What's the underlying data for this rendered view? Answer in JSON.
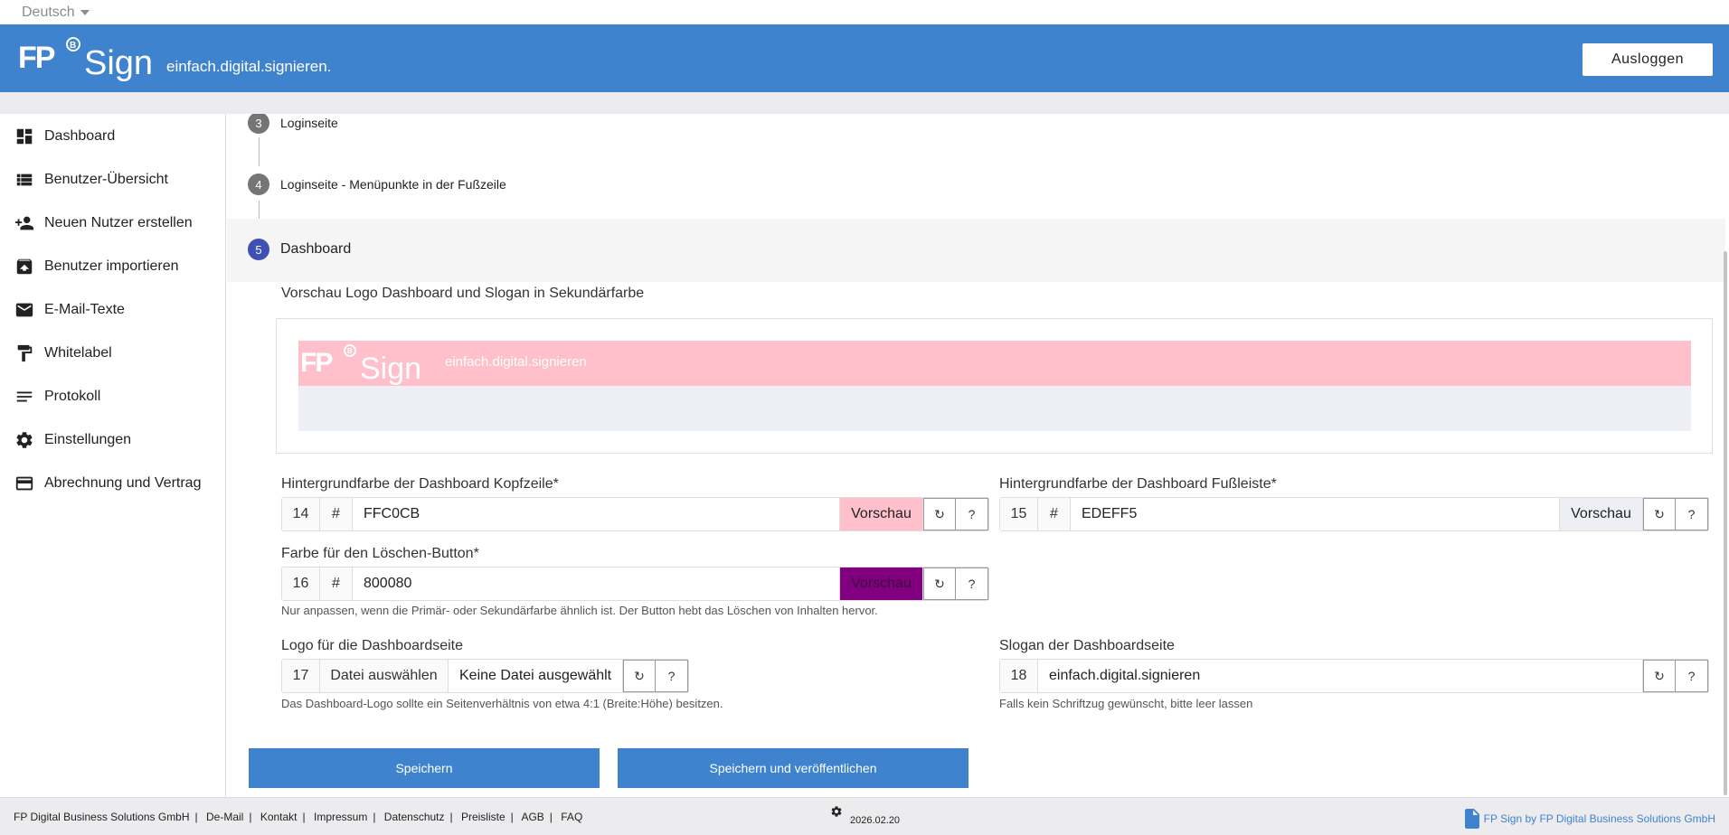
{
  "language": {
    "selected": "Deutsch"
  },
  "header": {
    "logo_text": "FP Sign",
    "slogan": "einfach.digital.signieren.",
    "logout_label": "Ausloggen",
    "color": "#3f83cf"
  },
  "sidebar": {
    "items": [
      {
        "label": "Dashboard",
        "icon": "dashboard-icon"
      },
      {
        "label": "Benutzer-Übersicht",
        "icon": "list-icon"
      },
      {
        "label": "Neuen Nutzer erstellen",
        "icon": "person-add-icon"
      },
      {
        "label": "Benutzer importieren",
        "icon": "archive-icon"
      },
      {
        "label": "E-Mail-Texte",
        "icon": "mail-icon"
      },
      {
        "label": "Whitelabel",
        "icon": "paint-roller-icon"
      },
      {
        "label": "Protokoll",
        "icon": "notes-icon"
      },
      {
        "label": "Einstellungen",
        "icon": "gear-icon"
      },
      {
        "label": "Abrechnung und Vertrag",
        "icon": "credit-card-icon"
      }
    ]
  },
  "steps": [
    {
      "num": "3",
      "label": "Loginseite"
    },
    {
      "num": "4",
      "label": "Loginseite - Menüpunkte in der Fußzeile"
    },
    {
      "num": "5",
      "label": "Dashboard"
    }
  ],
  "preview": {
    "title": "Vorschau Logo Dashboard und Slogan in Sekundärfarbe",
    "logo_text": "FP Sign",
    "slogan": "einfach.digital.signieren",
    "header_color": "#ffc0cb",
    "footer_color": "#edeff5"
  },
  "fields": {
    "header_bg": {
      "label": "Hintergrundfarbe der Dashboard Kopfzeile*",
      "num": "14",
      "hash": "#",
      "value": "FFC0CB",
      "preview": "Vorschau",
      "reset": "↻",
      "help_btn": "?"
    },
    "footer_bg": {
      "label": "Hintergrundfarbe der Dashboard Fußleiste*",
      "num": "15",
      "hash": "#",
      "value": "EDEFF5",
      "preview": "Vorschau",
      "reset": "↻",
      "help_btn": "?"
    },
    "delete_btn": {
      "label": "Farbe für den Löschen-Button*",
      "num": "16",
      "hash": "#",
      "value": "800080",
      "preview": "Vorschau",
      "reset": "↻",
      "help_btn": "?",
      "help": "Nur anpassen, wenn die Primär- oder Sekundärfarbe ähnlich ist. Der Button hebt das Löschen von Inhalten hervor."
    },
    "logo": {
      "label": "Logo für die Dashboardseite",
      "num": "17",
      "choose": "Datei auswählen",
      "none": "Keine Datei ausgewählt",
      "reset": "↻",
      "help_btn": "?",
      "help": "Das Dashboard-Logo sollte ein Seitenverhältnis von etwa 4:1 (Breite:Höhe) besitzen."
    },
    "slogan": {
      "label": "Slogan der Dashboardseite",
      "num": "18",
      "value": "einfach.digital.signieren",
      "reset": "↻",
      "help_btn": "?",
      "help": "Falls kein Schriftzug gewünscht, bitte leer lassen"
    }
  },
  "actions": {
    "save": "Speichern",
    "save_publish": "Speichern und veröffentlichen"
  },
  "footer": {
    "links": [
      "FP Digital Business Solutions GmbH",
      "De-Mail",
      "Kontakt",
      "Impressum",
      "Datenschutz",
      "Preisliste",
      "AGB",
      "FAQ"
    ],
    "version": "2026.02.20",
    "brand": "FP Sign by FP Digital Business Solutions GmbH"
  }
}
